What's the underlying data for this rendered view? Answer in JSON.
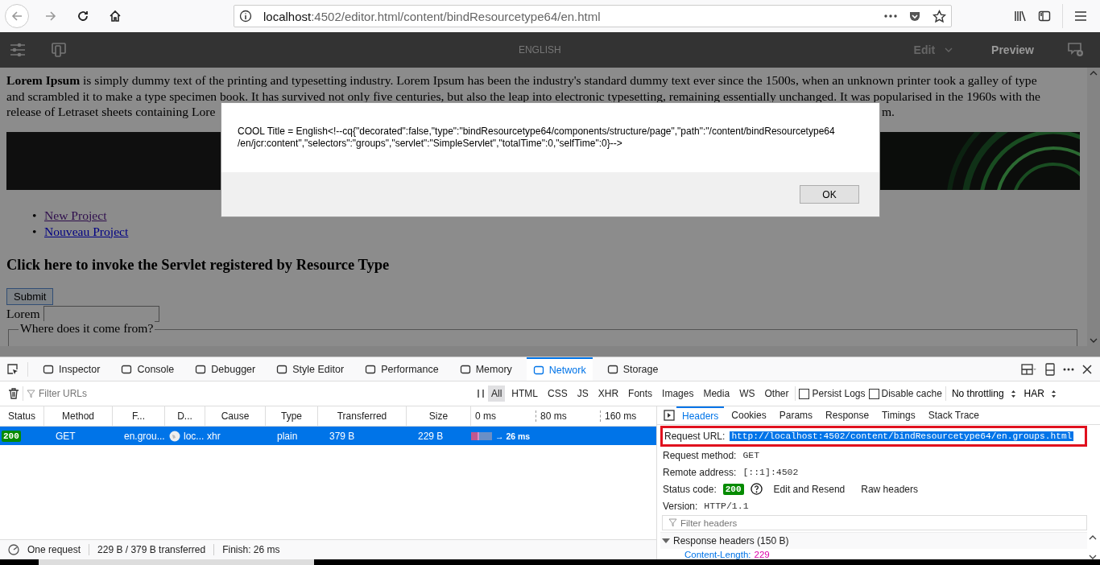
{
  "browser": {
    "url_host": "localhost",
    "url_rest": ":4502/editor.html/content/bindResourcetype64/en.html"
  },
  "editor_toolbar": {
    "title": "ENGLISH",
    "mode": "Edit",
    "preview": "Preview"
  },
  "page": {
    "lines": [
      "**Lorem Ipsum** is simply dummy text of the printing and typesetting industry. Lorem Ipsum has been the industry's standard dummy text ever since the 1500s, when an unknown printer took a galley of type",
      "and scrambled it to make a type specimen book. It has survived not only five centuries, but also the leap into electronic typesetting, remaining essentially unchanged. It was popularised in the 1960s with the"
    ],
    "line_3_start": "release of Letraset sheets containing Lore",
    "line_3_end": "m.",
    "banner": {
      "kind": "picture"
    },
    "links": [
      {
        "marker": "•",
        "label": "New Project",
        "visited": true
      },
      {
        "marker": "•",
        "label": "Nouveau Project",
        "visited": false
      }
    ],
    "heading": "Click here to invoke the Servlet registered by Resource Type",
    "submit": "Submit",
    "field_label": "Lorem",
    "fieldset_legend": "Where does it come from?"
  },
  "dialog": {
    "message": "COOL Title = English<!--cq{\"decorated\":false,\"type\":\"bindResourcetype64/components/structure/page\",\"path\":\"/content/bindResourcetype64 /en/jcr:content\",\"selectors\":\"groups\",\"servlet\":\"SimpleServlet\",\"totalTime\":0,\"selfTime\":0}-->",
    "ok": "OK"
  },
  "devtools": {
    "tabs": [
      {
        "label": "Inspector",
        "selected": false
      },
      {
        "label": "Console",
        "selected": false
      },
      {
        "label": "Debugger",
        "selected": false
      },
      {
        "label": "Style Editor",
        "selected": false
      },
      {
        "label": "Performance",
        "selected": false
      },
      {
        "label": "Memory",
        "selected": false
      },
      {
        "label": "Network",
        "selected": true
      },
      {
        "label": "Storage",
        "selected": false
      }
    ],
    "filter_placeholder": "Filter URLs",
    "type_filters": [
      {
        "label": "All",
        "selected": true
      },
      {
        "label": "HTML",
        "selected": false
      },
      {
        "label": "CSS",
        "selected": false
      },
      {
        "label": "JS",
        "selected": false
      },
      {
        "label": "XHR",
        "selected": false
      },
      {
        "label": "Fonts",
        "selected": false
      },
      {
        "label": "Images",
        "selected": false
      },
      {
        "label": "Media",
        "selected": false
      },
      {
        "label": "WS",
        "selected": false
      },
      {
        "label": "Other",
        "selected": false
      }
    ],
    "options": [
      {
        "label": "Persist Logs",
        "checked": false
      },
      {
        "label": "Disable cache",
        "checked": false
      }
    ],
    "throttling": "No throttling",
    "har": "HAR",
    "columns": [
      "Status",
      "Method",
      "F...",
      "D...",
      "Cause",
      "Type",
      "Transferred",
      "Size"
    ],
    "timeline_ticks": [
      "0 ms",
      "80 ms",
      "160 ms"
    ],
    "rows": [
      {
        "status": "200",
        "method": "GET",
        "file": "en.grou...",
        "domain": "loc...",
        "cause": "xhr",
        "type": "plain",
        "transferred": "379 B",
        "size": "229 B",
        "time": "→ 26 ms",
        "selected": true
      }
    ],
    "status_bar": [
      "One request",
      "229 B / 379 B transferred",
      "Finish: 26 ms"
    ],
    "detail_tabs": [
      {
        "label": "Headers",
        "selected": true
      },
      {
        "label": "Cookies",
        "selected": false
      },
      {
        "label": "Params",
        "selected": false
      },
      {
        "label": "Response",
        "selected": false
      },
      {
        "label": "Timings",
        "selected": false
      },
      {
        "label": "Stack Trace",
        "selected": false
      }
    ],
    "request_url": {
      "label": "Request URL:",
      "value": "http://localhost:4502/content/bindResourcetype64/en.groups.html"
    },
    "request_method": {
      "label": "Request method:",
      "value": "GET"
    },
    "remote_address": {
      "label": "Remote address:",
      "value": "[::1]:4502"
    },
    "status_code": {
      "label": "Status code:",
      "value": "200"
    },
    "actions": [
      "Edit and Resend",
      "Raw headers"
    ],
    "version": {
      "label": "Version:",
      "value": "HTTP/1.1"
    },
    "filter_headers_placeholder": "Filter headers",
    "response_headers": {
      "label": "Response headers (150 B)",
      "expanded": true,
      "items": [
        {
          "name": "Content-Length:",
          "value": "229"
        }
      ]
    }
  }
}
